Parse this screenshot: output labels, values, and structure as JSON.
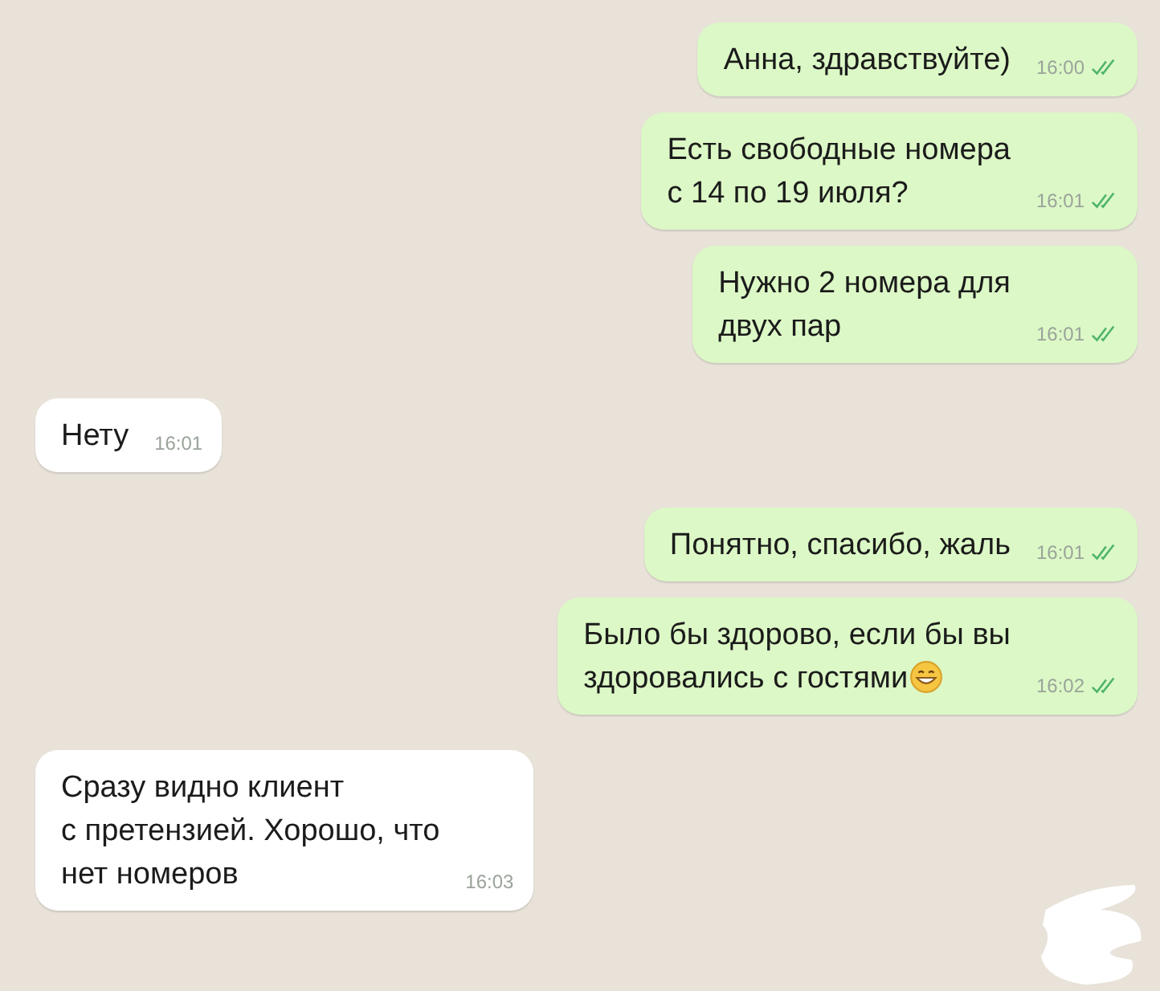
{
  "messages": [
    {
      "kind": "out",
      "text": "Анна, здравствуйте)",
      "time": "16:00",
      "read": true,
      "emoji": false
    },
    {
      "kind": "out",
      "text": "Есть свободные номера\nс 14 по 19 июля?",
      "time": "16:01",
      "read": true,
      "emoji": false
    },
    {
      "kind": "out",
      "text": "Нужно 2 номера для\nдвух пар",
      "time": "16:01",
      "read": true,
      "emoji": false
    },
    {
      "kind": "in",
      "text": "Нету",
      "time": "16:01",
      "emoji": false
    },
    {
      "kind": "out",
      "text": "Понятно, спасибо, жаль",
      "time": "16:01",
      "read": true,
      "emoji": false
    },
    {
      "kind": "out",
      "text": "Было бы здорово, если бы вы\nздоровались с гостями",
      "time": "16:02",
      "read": true,
      "emoji": true
    },
    {
      "kind": "in",
      "text": "Сразу видно клиент\nс претензией. Хорошо, что\nнет номеров",
      "time": "16:03",
      "emoji": false
    }
  ]
}
